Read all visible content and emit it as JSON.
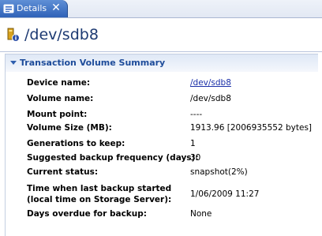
{
  "tab": {
    "label": "Details",
    "close_glyph": "✕",
    "icon": "details-icon"
  },
  "header": {
    "title": "/dev/sdb8",
    "icon": "device-icon"
  },
  "section": {
    "title": "Transaction Volume Summary",
    "toggle_icon": "expanded-triangle-icon",
    "rows": [
      {
        "label": "Device name:",
        "value": "/dev/sdb8"
      },
      {
        "label": "Volume name:",
        "value": "/dev/sdb8"
      },
      {
        "label": "Mount point:",
        "value": "----"
      },
      {
        "label": "Volume Size (MB):",
        "value": "1913.96 [2006935552 bytes]"
      },
      {
        "label": "Generations to keep:",
        "value": "1"
      },
      {
        "label": "Suggested backup frequency (days):",
        "value": "30"
      },
      {
        "label": "Current status:",
        "value": "snapshot(2%)"
      },
      {
        "label_line1": "Time when last backup started",
        "label_line2": "(local time on Storage Server):",
        "value": "1/06/2009 11:27"
      },
      {
        "label": "Days overdue for backup:",
        "value": "None"
      }
    ]
  },
  "colors": {
    "tab_active": "#3a6cc4",
    "title_text": "#1d3a72",
    "section_title": "#1e4c9a",
    "link": "#1a2fa8"
  }
}
